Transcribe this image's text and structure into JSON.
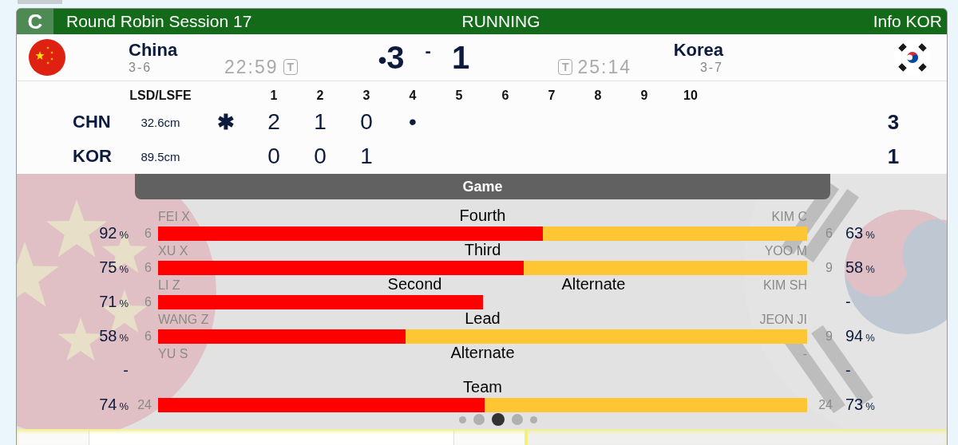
{
  "header": {
    "sheet": "C",
    "title": "Round Robin Session 17",
    "status": "RUNNING",
    "info": "Info KOR"
  },
  "teams": [
    {
      "name": "China",
      "record": "3-6",
      "clock": "22:59",
      "timeout_badge": "T",
      "score": "3",
      "hammer_dot": "•"
    },
    {
      "name": "Korea",
      "record": "3-7",
      "clock": "25:14",
      "timeout_badge": "T",
      "score": "1"
    }
  ],
  "score_separator": "-",
  "linescore": {
    "lsd_heading": "LSD/LSFE",
    "ends": [
      "1",
      "2",
      "3",
      "4",
      "5",
      "6",
      "7",
      "8",
      "9",
      "10"
    ],
    "rows": [
      {
        "abbr": "CHN",
        "lsd": "32.6cm",
        "marker": "✱",
        "ends": [
          "2",
          "1",
          "0",
          "•"
        ],
        "total": "3"
      },
      {
        "abbr": "KOR",
        "lsd": "89.5cm",
        "ends": [
          "0",
          "0",
          "1"
        ],
        "total": "1"
      }
    ]
  },
  "game": {
    "title": "Game",
    "rows": [
      {
        "kind": "match",
        "position": "Fourth",
        "level": 0.593,
        "chn": {
          "name": "FEI X",
          "count": "6",
          "pct": "92",
          "unit": "%"
        },
        "kor": {
          "name": "KIM C",
          "count": "6",
          "pct": "63",
          "unit": "%"
        }
      },
      {
        "kind": "match",
        "position": "Third",
        "level": 0.563,
        "chn": {
          "name": "XU X",
          "count": "6",
          "pct": "75",
          "unit": "%"
        },
        "kor": {
          "name": "YOO M",
          "count": "9",
          "pct": "58",
          "unit": "%"
        }
      },
      {
        "kind": "china_only",
        "chn_position": "Second",
        "kor_position": "Alternate",
        "chn": {
          "name": "LI Z",
          "count": "6",
          "pct": "71",
          "unit": "%"
        },
        "kor": {
          "name": "KIM SH",
          "pct": "-"
        }
      },
      {
        "kind": "match",
        "position": "Lead",
        "level": 0.381,
        "chn": {
          "name": "WANG Z",
          "count": "6",
          "pct": "58",
          "unit": "%"
        },
        "kor": {
          "name": "JEON JI",
          "count": "9",
          "pct": "94",
          "unit": "%"
        }
      },
      {
        "kind": "none",
        "position": "Alternate",
        "chn": {
          "name": "YU S",
          "pct": "-"
        },
        "kor": {
          "name": "-",
          "pct": "-"
        }
      },
      {
        "kind": "match",
        "position": "Team",
        "level": 0.503,
        "chn": {
          "count": "24",
          "pct": "74",
          "unit": "%"
        },
        "kor": {
          "count": "24",
          "pct": "73",
          "unit": "%"
        }
      }
    ]
  },
  "pager": [
    {
      "selected": false
    },
    {
      "selected": false
    },
    {
      "selected": true
    },
    {
      "selected": false
    },
    {
      "selected": false
    }
  ]
}
